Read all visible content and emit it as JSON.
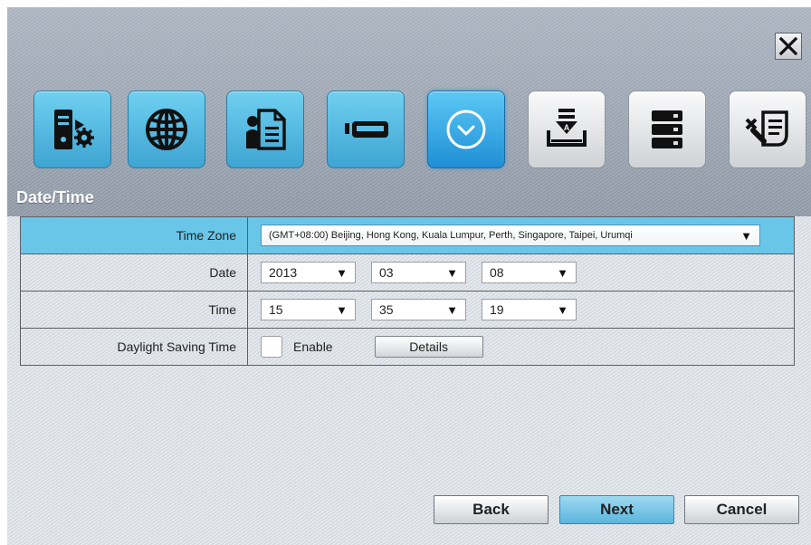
{
  "wizard": {
    "section_title": "Date/Time",
    "tabs": [
      {
        "icon": "server-settings-icon",
        "state": "done"
      },
      {
        "icon": "globe-icon",
        "state": "done"
      },
      {
        "icon": "user-document-icon",
        "state": "done"
      },
      {
        "icon": "card-reader-icon",
        "state": "done"
      },
      {
        "icon": "clock-icon",
        "state": "active"
      },
      {
        "icon": "install-tray-icon",
        "state": "pending"
      },
      {
        "icon": "storage-stack-icon",
        "state": "pending"
      },
      {
        "icon": "tools-list-icon",
        "state": "pending"
      }
    ]
  },
  "form": {
    "time_zone": {
      "label": "Time Zone",
      "value": "(GMT+08:00) Beijing, Hong Kong, Kuala Lumpur, Perth, Singapore, Taipei, Urumqi"
    },
    "date": {
      "label": "Date",
      "year": "2013",
      "month": "03",
      "day": "08"
    },
    "time": {
      "label": "Time",
      "hour": "15",
      "minute": "35",
      "second": "19"
    },
    "dst": {
      "label": "Daylight Saving Time",
      "enable_label": "Enable",
      "details_label": "Details",
      "enabled": false
    }
  },
  "footer": {
    "back_label": "Back",
    "next_label": "Next",
    "cancel_label": "Cancel"
  },
  "colors": {
    "active_tab": "#1f8fd6",
    "done_tab": "#3ea4d2",
    "highlight_row": "#6ac6e8"
  }
}
